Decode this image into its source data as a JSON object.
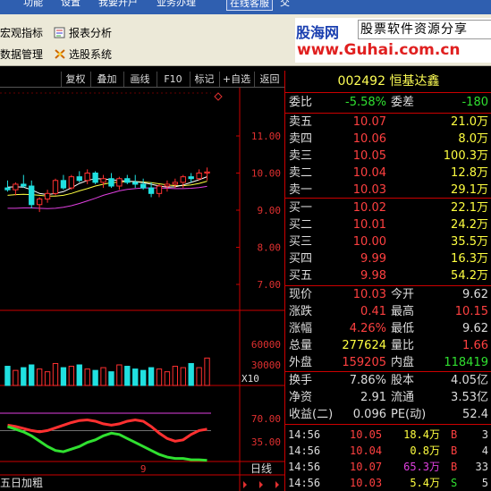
{
  "menu": {
    "items": [
      "功能",
      "设置",
      "我要开户",
      "业务办理"
    ],
    "service": "在线客服",
    "trail": "交"
  },
  "toolbar": {
    "items": [
      "宏观指标",
      "报表分析",
      "数据管理",
      "选股系统"
    ]
  },
  "logo": {
    "name": "股海网",
    "slogan": "股票软件资源分享",
    "url": "www.Guhai.com.cn"
  },
  "chart_header": {
    "buttons": [
      "复权",
      "叠加",
      "画线",
      "F10",
      "标记",
      "+自选",
      "返回"
    ]
  },
  "chart_data": {
    "type": "candlestick",
    "price_axis": [
      11.0,
      10.0,
      9.0,
      8.0,
      7.0
    ],
    "volume_axis": [
      60000,
      30000
    ],
    "volume_multiplier": "X10",
    "indicator_axis": [
      70.0,
      35.0
    ],
    "date_marker": "9",
    "bottom_tabs": [
      "五日加粗",
      "日线"
    ],
    "ohlc": [
      {
        "o": 9.6,
        "h": 9.8,
        "l": 9.5,
        "c": 9.55
      },
      {
        "o": 9.55,
        "h": 9.75,
        "l": 9.4,
        "c": 9.7
      },
      {
        "o": 9.7,
        "h": 9.95,
        "l": 9.6,
        "c": 9.65
      },
      {
        "o": 9.65,
        "h": 9.8,
        "l": 9.05,
        "c": 9.15
      },
      {
        "o": 9.15,
        "h": 9.35,
        "l": 8.95,
        "c": 9.3
      },
      {
        "o": 9.3,
        "h": 9.55,
        "l": 9.2,
        "c": 9.45
      },
      {
        "o": 9.45,
        "h": 9.85,
        "l": 9.4,
        "c": 9.8
      },
      {
        "o": 9.8,
        "h": 9.95,
        "l": 9.55,
        "c": 9.6
      },
      {
        "o": 9.6,
        "h": 9.95,
        "l": 9.55,
        "c": 9.9
      },
      {
        "o": 9.9,
        "h": 10.05,
        "l": 9.75,
        "c": 9.8
      },
      {
        "o": 9.8,
        "h": 10.1,
        "l": 9.7,
        "c": 10.0
      },
      {
        "o": 10.0,
        "h": 10.05,
        "l": 9.7,
        "c": 9.75
      },
      {
        "o": 9.75,
        "h": 9.95,
        "l": 9.6,
        "c": 9.85
      },
      {
        "o": 9.85,
        "h": 10.0,
        "l": 9.6,
        "c": 9.65
      },
      {
        "o": 9.65,
        "h": 9.9,
        "l": 9.55,
        "c": 9.85
      },
      {
        "o": 9.85,
        "h": 9.95,
        "l": 9.7,
        "c": 9.75
      },
      {
        "o": 9.75,
        "h": 9.95,
        "l": 9.6,
        "c": 9.7
      },
      {
        "o": 9.7,
        "h": 9.85,
        "l": 9.55,
        "c": 9.6
      },
      {
        "o": 9.6,
        "h": 9.75,
        "l": 9.35,
        "c": 9.45
      },
      {
        "o": 9.45,
        "h": 9.7,
        "l": 9.35,
        "c": 9.65
      },
      {
        "o": 9.65,
        "h": 9.8,
        "l": 9.5,
        "c": 9.7
      },
      {
        "o": 9.7,
        "h": 9.85,
        "l": 9.6,
        "c": 9.75
      },
      {
        "o": 9.75,
        "h": 9.95,
        "l": 9.6,
        "c": 9.9
      },
      {
        "o": 9.9,
        "h": 10.0,
        "l": 9.75,
        "c": 9.85
      },
      {
        "o": 9.85,
        "h": 10.1,
        "l": 9.8,
        "c": 10.0
      },
      {
        "o": 10.0,
        "h": 10.15,
        "l": 9.8,
        "c": 10.03
      }
    ],
    "volume": [
      28000,
      22000,
      26000,
      30000,
      24000,
      20000,
      32000,
      26000,
      28000,
      30000,
      24000,
      22000,
      26000,
      20000,
      30000,
      28000,
      24000,
      22000,
      26000,
      24000,
      20000,
      28000,
      26000,
      32000,
      26000,
      40000
    ],
    "ma5": [
      9.62,
      9.63,
      9.62,
      9.55,
      9.45,
      9.42,
      9.45,
      9.5,
      9.6,
      9.72,
      9.8,
      9.85,
      9.84,
      9.82,
      9.8,
      9.78,
      9.77,
      9.74,
      9.7,
      9.65,
      9.62,
      9.63,
      9.68,
      9.75,
      9.82,
      9.9
    ],
    "ma10": [
      9.4,
      9.42,
      9.43,
      9.42,
      9.4,
      9.38,
      9.38,
      9.4,
      9.45,
      9.52,
      9.58,
      9.65,
      9.7,
      9.74,
      9.76,
      9.77,
      9.77,
      9.76,
      9.74,
      9.71,
      9.68,
      9.66,
      9.66,
      9.68,
      9.72,
      9.78
    ],
    "ma20": [
      9.05,
      9.05,
      9.06,
      9.06,
      9.05,
      9.04,
      9.05,
      9.08,
      9.12,
      9.18,
      9.25,
      9.32,
      9.4,
      9.46,
      9.52,
      9.56,
      9.58,
      9.6,
      9.6,
      9.6,
      9.59,
      9.58,
      9.58,
      9.59,
      9.61,
      9.64
    ],
    "ind_red": [
      60,
      58,
      55,
      52,
      50,
      52,
      56,
      60,
      64,
      67,
      68,
      66,
      62,
      60,
      62,
      66,
      68,
      66,
      58,
      48,
      40,
      36,
      38,
      46,
      52,
      54
    ],
    "ind_green": [
      58,
      54,
      50,
      44,
      36,
      28,
      22,
      20,
      24,
      28,
      34,
      38,
      44,
      48,
      46,
      40,
      34,
      28,
      22,
      16,
      12,
      10,
      10,
      8,
      8,
      7
    ]
  },
  "quote": {
    "title": "002492 恒基达鑫",
    "weibi_label": "委比",
    "weibi_value": "-5.58%",
    "weicha_label": "委差",
    "weicha_value": "-180",
    "asks": [
      {
        "label": "卖五",
        "price": "10.07",
        "vol": "21.0万"
      },
      {
        "label": "卖四",
        "price": "10.06",
        "vol": "8.0万"
      },
      {
        "label": "卖三",
        "price": "10.05",
        "vol": "100.3万"
      },
      {
        "label": "卖二",
        "price": "10.04",
        "vol": "12.8万"
      },
      {
        "label": "卖一",
        "price": "10.03",
        "vol": "29.1万"
      }
    ],
    "bids": [
      {
        "label": "买一",
        "price": "10.02",
        "vol": "22.1万"
      },
      {
        "label": "买二",
        "price": "10.01",
        "vol": "24.2万"
      },
      {
        "label": "买三",
        "price": "10.00",
        "vol": "35.5万"
      },
      {
        "label": "买四",
        "price": "9.99",
        "vol": "16.3万"
      },
      {
        "label": "买五",
        "price": "9.98",
        "vol": "54.2万"
      }
    ],
    "stats": [
      {
        "l1": "现价",
        "v1": "10.03",
        "l2": "今开",
        "v2": "9.62",
        "c1": "red",
        "c2": "white"
      },
      {
        "l1": "涨跌",
        "v1": "0.41",
        "l2": "最高",
        "v2": "10.15",
        "c1": "red",
        "c2": "red"
      },
      {
        "l1": "涨幅",
        "v1": "4.26%",
        "l2": "最低",
        "v2": "9.62",
        "c1": "red",
        "c2": "white"
      },
      {
        "l1": "总量",
        "v1": "277624",
        "l2": "量比",
        "v2": "1.66",
        "c1": "yellow",
        "c2": "red"
      },
      {
        "l1": "外盘",
        "v1": "159205",
        "l2": "内盘",
        "v2": "118419",
        "c1": "red",
        "c2": "green"
      }
    ],
    "stats2": [
      {
        "l1": "换手",
        "v1": "7.86%",
        "l2": "股本",
        "v2": "4.05亿"
      },
      {
        "l1": "净资",
        "v1": "2.91",
        "l2": "流通",
        "v2": "3.53亿"
      },
      {
        "l1": "收益(二)",
        "v1": "0.096",
        "l2": "PE(动)",
        "v2": "52.4"
      }
    ],
    "trades": [
      {
        "time": "14:56",
        "price": "10.05",
        "vol": "18.4万",
        "side": "B",
        "count": "3",
        "vc": "yellow",
        "sc": "red"
      },
      {
        "time": "14:56",
        "price": "10.04",
        "vol": "0.8万",
        "side": "B",
        "count": "4",
        "vc": "yellow",
        "sc": "red"
      },
      {
        "time": "14:56",
        "price": "10.07",
        "vol": "65.3万",
        "side": "B",
        "count": "33",
        "vc": "magenta",
        "sc": "red"
      },
      {
        "time": "14:56",
        "price": "10.03",
        "vol": "5.4万",
        "side": "S",
        "count": "5",
        "vc": "yellow",
        "sc": "green"
      }
    ]
  },
  "colors": {
    "up": "#ff3030",
    "down": "#20e0e0",
    "ma5": "#ffffff",
    "ma10": "#ffff40",
    "ma20": "#e040e0",
    "panel_border": "#cc0000"
  }
}
